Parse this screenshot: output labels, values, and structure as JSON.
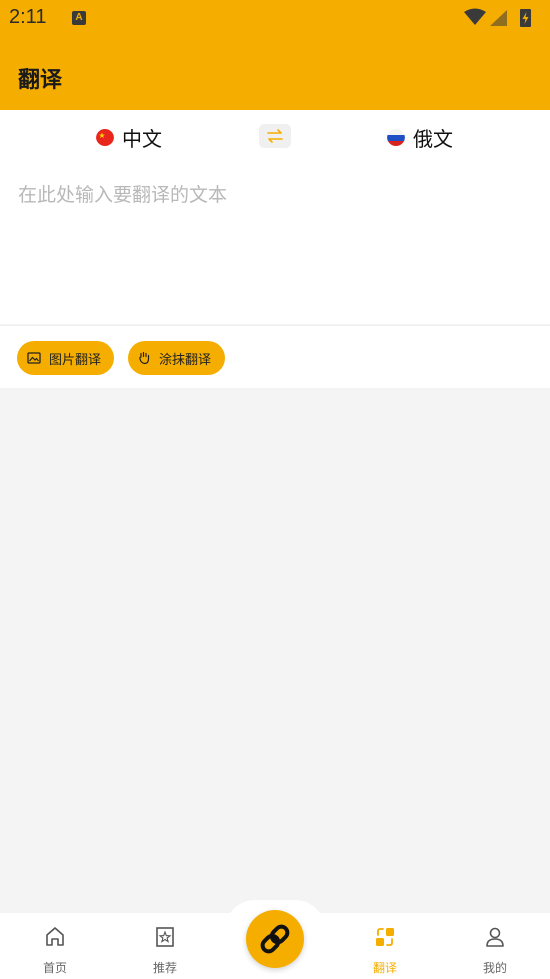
{
  "status_bar": {
    "time": "2:11",
    "notification_letter": "A"
  },
  "header": {
    "title": "翻译"
  },
  "languages": {
    "source": "中文",
    "target": "俄文"
  },
  "input": {
    "placeholder": "在此处输入要翻译的文本"
  },
  "actions": {
    "photo_label": "图片翻译",
    "smear_label": "涂抹翻译"
  },
  "bottom_nav": {
    "home": "首页",
    "recommend": "推荐",
    "translate": "翻译",
    "mine": "我的"
  },
  "colors": {
    "accent": "#f5ae00",
    "background": "#f4f4f4"
  }
}
